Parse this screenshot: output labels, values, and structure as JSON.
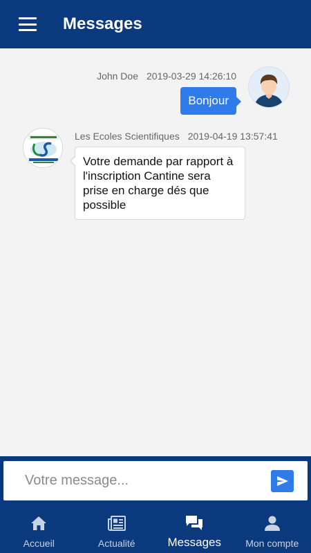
{
  "appbar": {
    "menu_icon": "hamburger-menu-icon",
    "title": "Messages"
  },
  "messages": [
    {
      "direction": "outgoing",
      "sender": "John Doe",
      "timestamp": "2019-03-29 14:26:10",
      "text": "Bonjour",
      "avatar_icon": "user-avatar"
    },
    {
      "direction": "incoming",
      "sender": "Les Ecoles Scientifiques",
      "timestamp": "2019-04-19 13:57:41",
      "text": "Votre demande par rapport à l'inscription Cantine sera prise en charge dés que possible",
      "avatar_icon": "school-logo"
    }
  ],
  "composer": {
    "placeholder": "Votre message...",
    "send_icon": "send-icon"
  },
  "bottom_nav": {
    "items": [
      {
        "label": "Accueil",
        "icon": "home-icon",
        "active": false
      },
      {
        "label": "Actualité",
        "icon": "newspaper-icon",
        "active": false
      },
      {
        "label": "Messages",
        "icon": "chat-icon",
        "active": true
      },
      {
        "label": "Mon compte",
        "icon": "person-icon",
        "active": false
      }
    ]
  },
  "colors": {
    "primary": "#0a3a7d",
    "accent": "#2f7bea",
    "background": "#f3f3f4"
  }
}
